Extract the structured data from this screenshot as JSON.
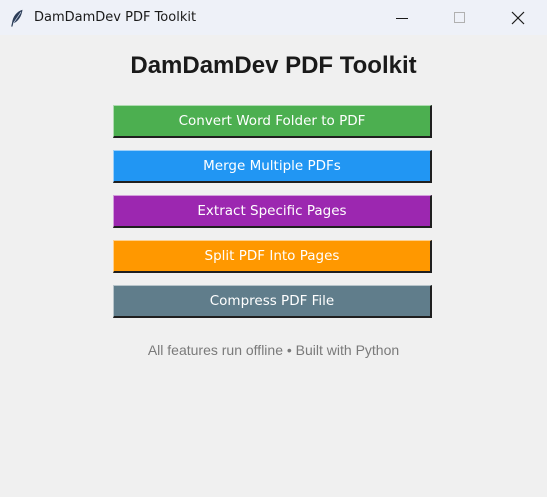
{
  "window": {
    "title": "DamDamDev PDF Toolkit",
    "icon": "feather-icon",
    "controls": [
      "minimize-icon",
      "maximize-icon",
      "close-icon"
    ]
  },
  "main": {
    "title": "DamDamDev PDF Toolkit",
    "buttons": [
      {
        "label": "Convert Word Folder to PDF",
        "color": "#4caf50"
      },
      {
        "label": "Merge Multiple PDFs",
        "color": "#2196f3"
      },
      {
        "label": "Extract Specific Pages",
        "color": "#9c27b0"
      },
      {
        "label": "Split PDF Into Pages",
        "color": "#ff9800"
      },
      {
        "label": "Compress PDF File",
        "color": "#607d8b"
      }
    ],
    "footer": "All features run offline • Built with Python"
  },
  "colors": {
    "background": "#f0f0f0",
    "titlebar": "#eef1f8"
  }
}
